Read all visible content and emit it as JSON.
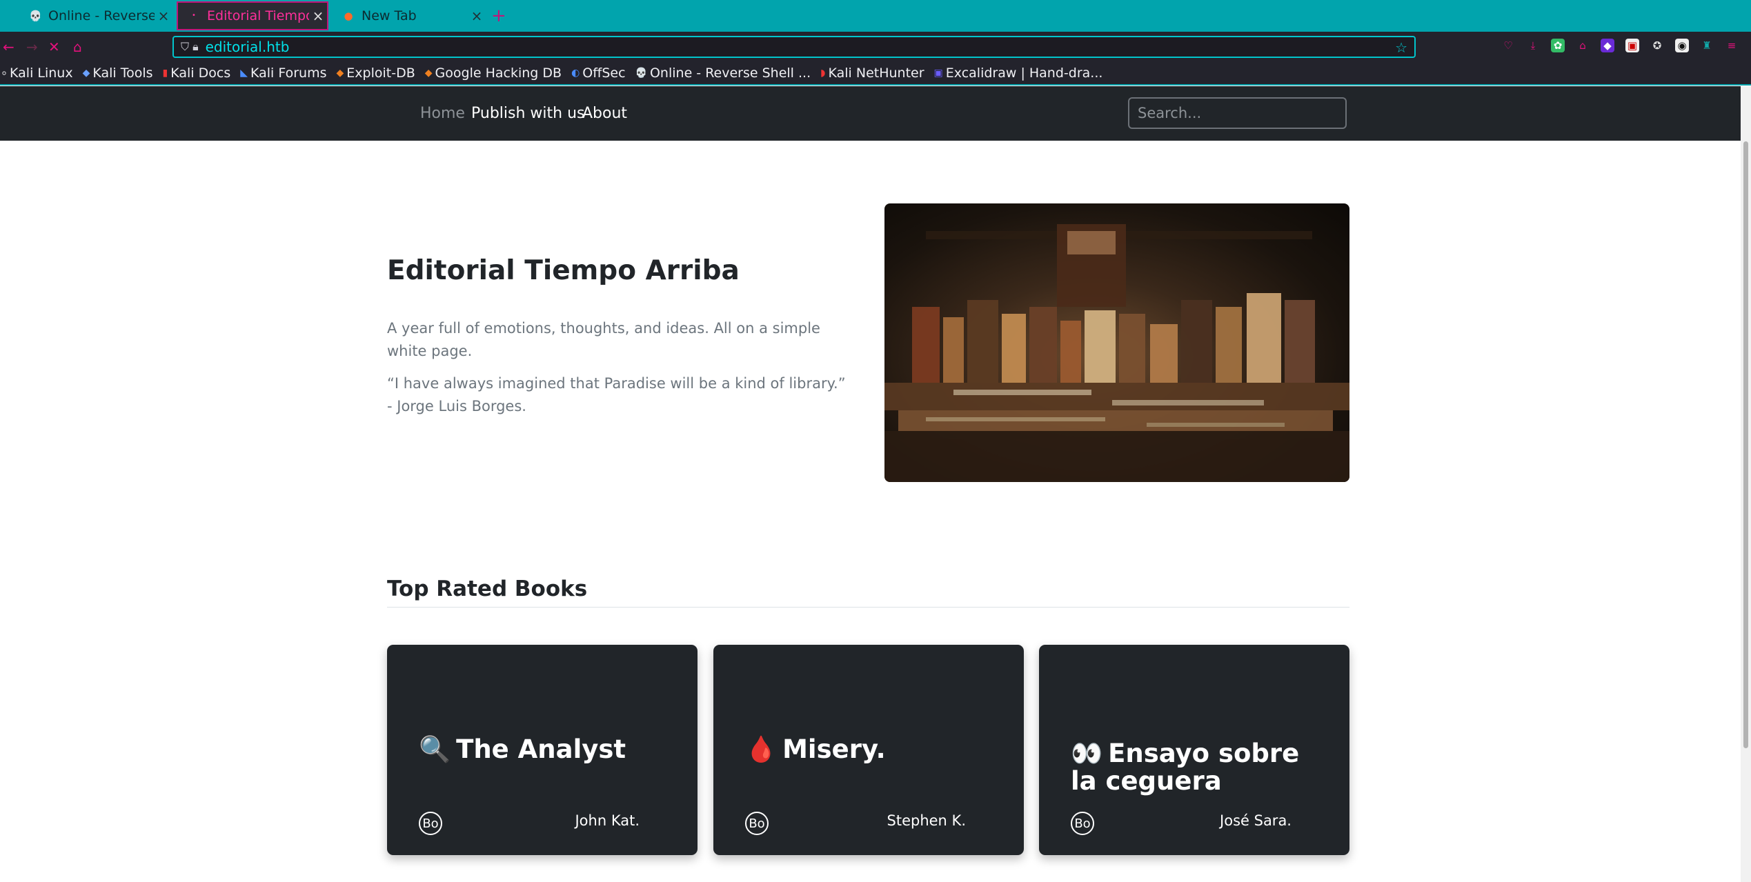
{
  "browser": {
    "tabs": [
      {
        "title": "Online - Reverse Sh",
        "icon": "skull-icon",
        "active": false
      },
      {
        "title": "Editorial Tiempo Ar",
        "icon": "dot-icon",
        "active": true
      },
      {
        "title": "New Tab",
        "icon": "firefox-icon",
        "active": false
      }
    ],
    "new_tab": "+",
    "url": "editorial.htb",
    "bookmarks": [
      {
        "label": "Kali Linux",
        "icon": "kali-icon"
      },
      {
        "label": "Kali Tools",
        "icon": "kali-tools-icon"
      },
      {
        "label": "Kali Docs",
        "icon": "kali-docs-icon"
      },
      {
        "label": "Kali Forums",
        "icon": "kali-forums-icon"
      },
      {
        "label": "Exploit-DB",
        "icon": "exploit-db-icon"
      },
      {
        "label": "Google Hacking DB",
        "icon": "ghdb-icon"
      },
      {
        "label": "OffSec",
        "icon": "offsec-icon"
      },
      {
        "label": "Online - Reverse Shell ...",
        "icon": "skull-icon"
      },
      {
        "label": "Kali NetHunter",
        "icon": "nethunter-icon"
      },
      {
        "label": "Excalidraw | Hand-dra...",
        "icon": "excalidraw-icon"
      }
    ]
  },
  "site": {
    "nav": {
      "home": "Home",
      "publish": "Publish with us",
      "about": "About",
      "search_placeholder": "Search..."
    },
    "hero": {
      "title": "Editorial Tiempo Arriba",
      "line1": "A year full of emotions, thoughts, and ideas. All on a simple white page.",
      "line2": "“I have always imagined that Paradise will be a kind of library.” - Jorge Luis Borges."
    },
    "section_title": "Top Rated Books",
    "books": [
      {
        "emoji": "🔍",
        "title": "The Analyst",
        "badge": "Bo",
        "author": "John Kat."
      },
      {
        "emoji": "🩸",
        "title": "Misery.",
        "badge": "Bo",
        "author": "Stephen K."
      },
      {
        "emoji": "👀",
        "title": "Ensayo sobre la ceguera",
        "badge": "Bo",
        "author": "José Sara."
      }
    ]
  },
  "colors": {
    "tabbar": "#01a4ad",
    "chrome": "#23232c",
    "accent_pink": "#e4117c",
    "site_dark": "#212529"
  }
}
